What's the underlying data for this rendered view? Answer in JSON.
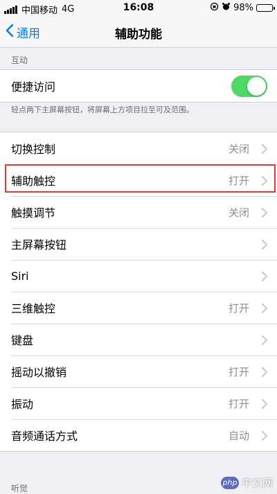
{
  "status_bar": {
    "carrier": "中国移动",
    "network": "4G",
    "time": "16:08",
    "battery": "98%",
    "battery_level": 0.98
  },
  "nav": {
    "back_label": "通用",
    "title": "辅助功能"
  },
  "section_interaction": {
    "header": "互动",
    "reachability": {
      "label": "便捷访问",
      "on": true
    },
    "footnote": "轻点两下主屏幕按钮，将屏幕上方项目拉至可及范围。"
  },
  "items": [
    {
      "label": "切换控制",
      "value": "关闭"
    },
    {
      "label": "辅助触控",
      "value": "打开"
    },
    {
      "label": "触摸调节",
      "value": "关闭"
    },
    {
      "label": "主屏幕按钮",
      "value": ""
    },
    {
      "label": "Siri",
      "value": ""
    },
    {
      "label": "三维触控",
      "value": "打开"
    },
    {
      "label": "键盘",
      "value": ""
    },
    {
      "label": "摇动以撤销",
      "value": "打开"
    },
    {
      "label": "振动",
      "value": "打开"
    },
    {
      "label": "音频通话方式",
      "value": "自动"
    }
  ],
  "section_hearing": {
    "header": "听觉"
  },
  "watermark": {
    "badge": "php",
    "text": "中文网"
  },
  "colors": {
    "accent": "#0a7aff",
    "toggle_on": "#4cd964",
    "highlight": "#e53935"
  }
}
